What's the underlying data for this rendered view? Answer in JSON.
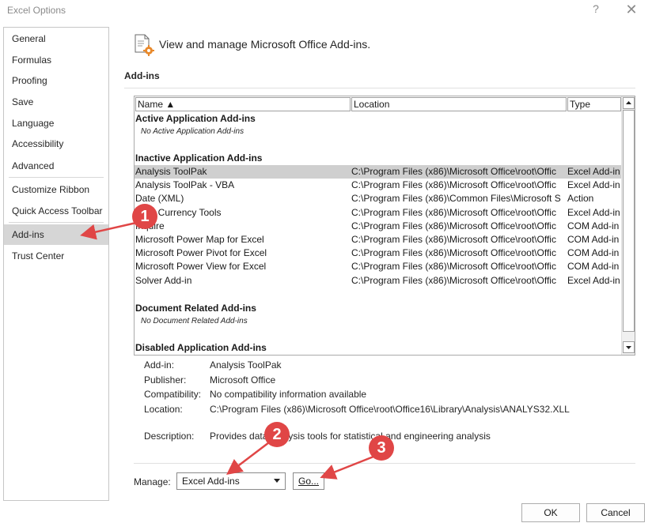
{
  "window": {
    "title": "Excel Options",
    "help_glyph": "?",
    "close_glyph": "✕"
  },
  "sidebar": {
    "items": [
      {
        "label": "General"
      },
      {
        "label": "Formulas"
      },
      {
        "label": "Proofing"
      },
      {
        "label": "Save"
      },
      {
        "label": "Language"
      },
      {
        "label": "Accessibility"
      },
      {
        "label": "Advanced"
      },
      {
        "label": "Customize Ribbon"
      },
      {
        "label": "Quick Access Toolbar"
      },
      {
        "label": "Add-ins",
        "selected": true
      },
      {
        "label": "Trust Center"
      }
    ]
  },
  "main": {
    "header": "View and manage Microsoft Office Add-ins.",
    "section_title": "Add-ins",
    "columns": {
      "name": "Name ▲",
      "location": "Location",
      "type": "Type"
    },
    "groups": {
      "active": {
        "title": "Active Application Add-ins",
        "empty": "No Active Application Add-ins"
      },
      "inactive": {
        "title": "Inactive Application Add-ins",
        "rows": [
          {
            "name": "Analysis ToolPak",
            "location": "C:\\Program Files (x86)\\Microsoft Office\\root\\Offic",
            "type": "Excel Add-in",
            "selected": true
          },
          {
            "name": "Analysis ToolPak - VBA",
            "location": "C:\\Program Files (x86)\\Microsoft Office\\root\\Offic",
            "type": "Excel Add-in"
          },
          {
            "name": "Date (XML)",
            "location": "C:\\Program Files (x86)\\Common Files\\Microsoft S",
            "type": "Action"
          },
          {
            "name": "Euro Currency Tools",
            "location": "C:\\Program Files (x86)\\Microsoft Office\\root\\Offic",
            "type": "Excel Add-in"
          },
          {
            "name": "Inquire",
            "location": "C:\\Program Files (x86)\\Microsoft Office\\root\\Offic",
            "type": "COM Add-in"
          },
          {
            "name": "Microsoft Power Map for Excel",
            "location": "C:\\Program Files (x86)\\Microsoft Office\\root\\Offic",
            "type": "COM Add-in"
          },
          {
            "name": "Microsoft Power Pivot for Excel",
            "location": "C:\\Program Files (x86)\\Microsoft Office\\root\\Offic",
            "type": "COM Add-in"
          },
          {
            "name": "Microsoft Power View for Excel",
            "location": "C:\\Program Files (x86)\\Microsoft Office\\root\\Offic",
            "type": "COM Add-in"
          },
          {
            "name": "Solver Add-in",
            "location": "C:\\Program Files (x86)\\Microsoft Office\\root\\Offic",
            "type": "Excel Add-in"
          }
        ]
      },
      "document": {
        "title": "Document Related Add-ins",
        "empty": "No Document Related Add-ins"
      },
      "disabled": {
        "title": "Disabled Application Add-ins"
      }
    },
    "details": {
      "addin_label": "Add-in:",
      "addin_value": "Analysis ToolPak",
      "publisher_label": "Publisher:",
      "publisher_value": "Microsoft Office",
      "compat_label": "Compatibility:",
      "compat_value": "No compatibility information available",
      "location_label": "Location:",
      "location_value": "C:\\Program Files (x86)\\Microsoft Office\\root\\Office16\\Library\\Analysis\\ANALYS32.XLL",
      "description_label": "Description:",
      "description_value": "Provides data analysis tools for statistical and engineering analysis"
    },
    "manage": {
      "label": "Manage:",
      "selected": "Excel Add-ins",
      "go_label": "Go..."
    }
  },
  "footer": {
    "ok_label": "OK",
    "cancel_label": "Cancel"
  },
  "annotations": {
    "badges": [
      "1",
      "2",
      "3"
    ],
    "color": "#e04646"
  }
}
